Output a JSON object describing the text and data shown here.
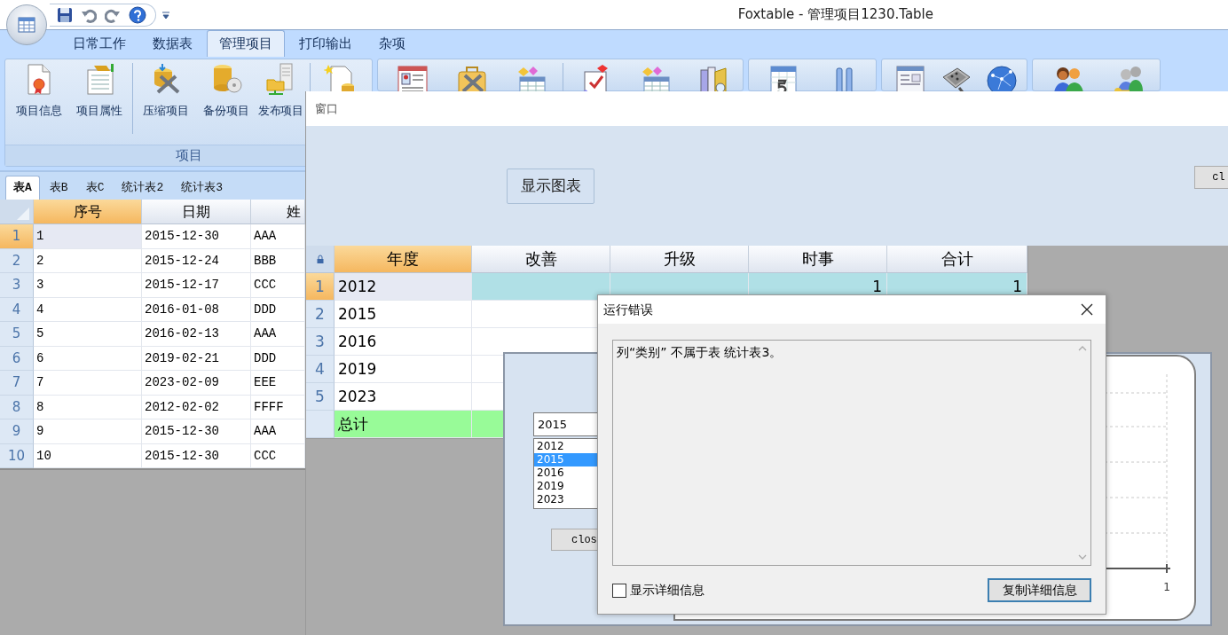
{
  "app": {
    "title": "Foxtable - 管理项目1230.Table"
  },
  "ribbon": {
    "tabs": [
      {
        "label": "日常工作",
        "selected": false
      },
      {
        "label": "数据表",
        "selected": false
      },
      {
        "label": "管理项目",
        "selected": true
      },
      {
        "label": "打印输出",
        "selected": false
      },
      {
        "label": "杂项",
        "selected": false
      }
    ],
    "group": {
      "label": "项目",
      "buttons": [
        "项目信息",
        "项目属性",
        "压缩项目",
        "备份项目",
        "发布项目"
      ]
    }
  },
  "sheet_tabs": [
    {
      "label": "表A",
      "selected": true
    },
    {
      "label": "表B",
      "selected": false
    },
    {
      "label": "表C",
      "selected": false
    },
    {
      "label": "统计表2",
      "selected": false
    },
    {
      "label": "统计表3",
      "selected": false
    }
  ],
  "table": {
    "columns": [
      {
        "label": "序号",
        "selected": true
      },
      {
        "label": "日期",
        "selected": false
      },
      {
        "label": "姓",
        "selected": false
      }
    ],
    "rows": [
      {
        "number": "1",
        "cells": [
          "1",
          "2015-12-30",
          "AAA"
        ],
        "selected": true
      },
      {
        "number": "2",
        "cells": [
          "2",
          "2015-12-24",
          "BBB"
        ],
        "selected": false
      },
      {
        "number": "3",
        "cells": [
          "3",
          "2015-12-17",
          "CCC"
        ],
        "selected": false
      },
      {
        "number": "4",
        "cells": [
          "4",
          "2016-01-08",
          "DDD"
        ],
        "selected": false
      },
      {
        "number": "5",
        "cells": [
          "5",
          "2016-02-13",
          "AAA"
        ],
        "selected": false
      },
      {
        "number": "6",
        "cells": [
          "6",
          "2019-02-21",
          "DDD"
        ],
        "selected": false
      },
      {
        "number": "7",
        "cells": [
          "7",
          "2023-02-09",
          "EEE"
        ],
        "selected": false
      },
      {
        "number": "8",
        "cells": [
          "8",
          "2012-02-02",
          "FFFF"
        ],
        "selected": false
      },
      {
        "number": "9",
        "cells": [
          "9",
          "2015-12-30",
          "AAA"
        ],
        "selected": false
      },
      {
        "number": "10",
        "cells": [
          "10",
          "2015-12-30",
          "CCC"
        ],
        "selected": false
      }
    ]
  },
  "form_window": {
    "title": "窗口",
    "buttons": [
      "显示图表",
      "cl"
    ],
    "grid": {
      "columns": [
        {
          "label": "年度",
          "selected": true
        },
        {
          "label": "改善",
          "selected": false
        },
        {
          "label": "升级",
          "selected": false
        },
        {
          "label": "时事",
          "selected": false
        },
        {
          "label": "合计",
          "selected": false
        }
      ],
      "rows": [
        {
          "number": "1",
          "cells": [
            "2012",
            null,
            null,
            "1",
            "1"
          ],
          "selected": true
        },
        {
          "number": "2",
          "cells": [
            "2015"
          ],
          "selected": false
        },
        {
          "number": "3",
          "cells": [
            "2016"
          ],
          "selected": false
        },
        {
          "number": "4",
          "cells": [
            "2019"
          ],
          "selected": false
        },
        {
          "number": "5",
          "cells": [
            "2023"
          ],
          "selected": false
        }
      ],
      "total": {
        "label": "总计"
      }
    }
  },
  "chart_window": {
    "field": {
      "value": "2015"
    },
    "list": [
      {
        "label": "2012",
        "selected": false
      },
      {
        "label": "2015",
        "selected": true
      },
      {
        "label": "2016",
        "selected": false
      },
      {
        "label": "2019",
        "selected": false
      },
      {
        "label": "2023",
        "selected": false
      }
    ],
    "close_button": "clos",
    "axis_label": "1"
  },
  "error_dialog": {
    "title": "运行错误",
    "message": "列“类别” 不属于表 统计表3。",
    "checkbox": {
      "label": "显示详细信息",
      "checked": false
    },
    "button": "复制详细信息"
  }
}
